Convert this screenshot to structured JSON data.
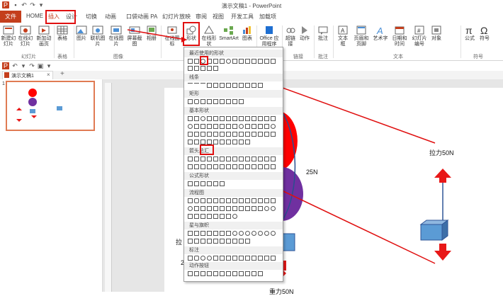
{
  "window": {
    "title": "演示文稿1 - PowerPoint"
  },
  "tabs": {
    "file": "文件",
    "items": [
      "HOME",
      "插入",
      "设计",
      "切换",
      "动画",
      "口袋动画 PA",
      "幻灯片放映",
      "审阅",
      "视图",
      "开发工具",
      "加载项"
    ]
  },
  "ribbon": {
    "buttons": [
      "新建幻灯片",
      "在线幻灯片",
      "新加动画页",
      "表格",
      "图片",
      "联机图片",
      "在线图片",
      "屏幕截图",
      "相册",
      "在线图标",
      "形状",
      "在线形状",
      "SmartArt",
      "图表",
      "Office 应用程序",
      "超链接",
      "动作",
      "批注",
      "文本框",
      "页眉和页脚",
      "艺术字",
      "日期和时间",
      "幻灯片编号",
      "对象",
      "公式",
      "符号"
    ],
    "groups": [
      "幻灯片",
      "表格",
      "图像",
      "链接",
      "批注",
      "文本",
      "符号"
    ]
  },
  "file_tab": {
    "label": "演示文稿1"
  },
  "thumbnail": {
    "number": "1"
  },
  "shapes_panel": {
    "categories": [
      "最近使用的形状",
      "线条",
      "矩形",
      "基本形状",
      "箭头总汇",
      "公式形状",
      "流程图",
      "星与旗帜",
      "标注",
      "动作按钮"
    ]
  },
  "slide": {
    "labels": [
      "25N",
      "拉力50N",
      "拉",
      "25",
      "重力50N"
    ]
  },
  "colors": {
    "accent": "#c43e1c",
    "annotation": "#e01010",
    "red_ball": "#ff0000",
    "purple_ball": "#7030a0",
    "box": "#5b9bd5",
    "arrow": "#e81818"
  }
}
